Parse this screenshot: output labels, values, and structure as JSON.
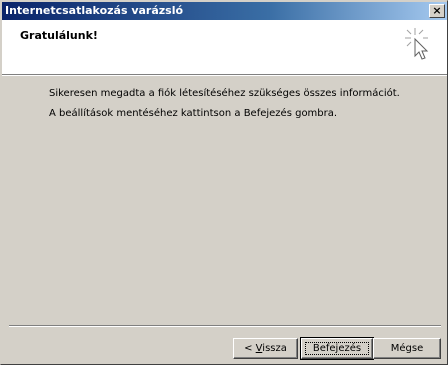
{
  "window": {
    "title": "Internetcsatlakozás varázsló",
    "close_glyph": "×"
  },
  "header": {
    "title": "Gratulálunk!",
    "icon": "wizard-cursor-icon"
  },
  "content": {
    "line1": "Sikeresen megadta a fiók létesítéséhez szükséges összes információt.",
    "line2": "A beállítások mentéséhez kattintson a Befejezés gombra."
  },
  "buttons": {
    "back_prefix": "< ",
    "back_mnemonic": "V",
    "back_rest": "issza",
    "finish": "Befejezés",
    "cancel": "Mégse"
  },
  "colors": {
    "titlebar_start": "#0a246a",
    "titlebar_end": "#a6caf0",
    "face": "#d4d0c8"
  }
}
